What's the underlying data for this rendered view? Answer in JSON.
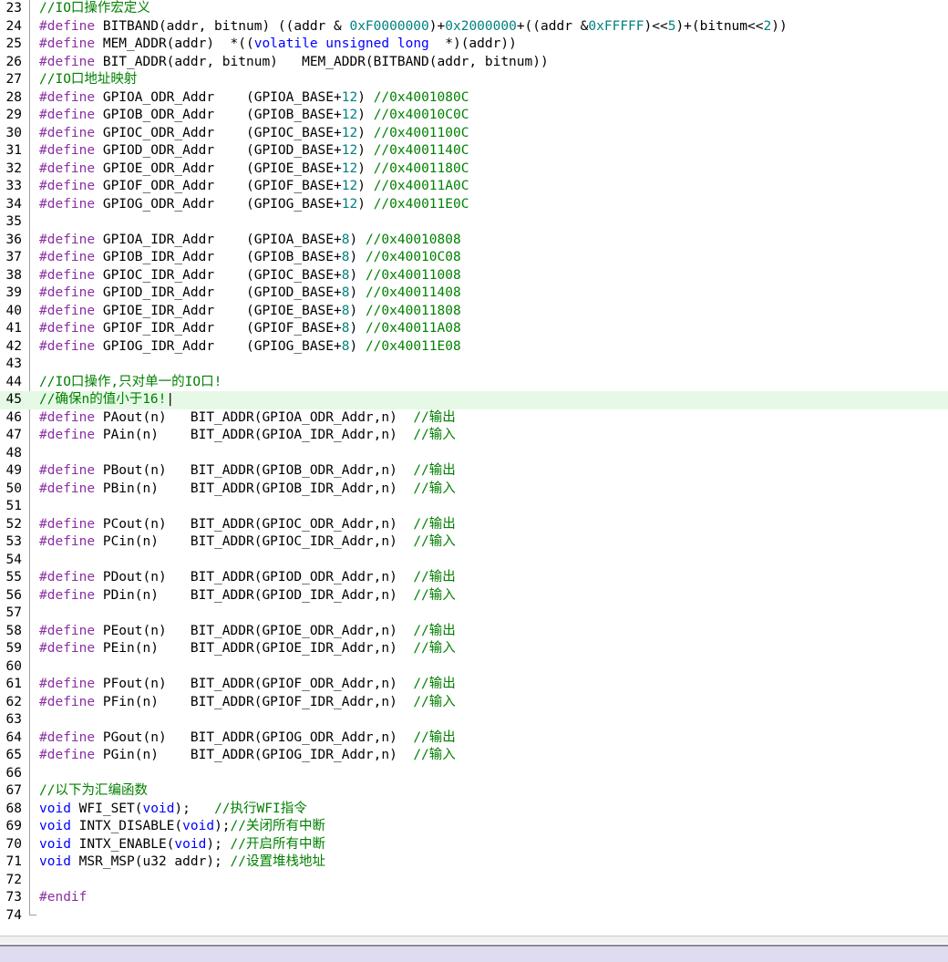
{
  "editor": {
    "lines": [
      {
        "n": "23",
        "tokens": [
          {
            "c": "com",
            "t": "//IO口操作宏定义"
          }
        ]
      },
      {
        "n": "24",
        "tokens": [
          {
            "c": "pre",
            "t": "#define "
          },
          {
            "c": "txt",
            "t": "BITBAND(addr, bitnum) ((addr & "
          },
          {
            "c": "num",
            "t": "0xF0000000"
          },
          {
            "c": "txt",
            "t": ")+"
          },
          {
            "c": "num",
            "t": "0x2000000"
          },
          {
            "c": "txt",
            "t": "+((addr &"
          },
          {
            "c": "num",
            "t": "0xFFFFF"
          },
          {
            "c": "txt",
            "t": ")<<"
          },
          {
            "c": "num",
            "t": "5"
          },
          {
            "c": "txt",
            "t": ")+(bitnum<<"
          },
          {
            "c": "num",
            "t": "2"
          },
          {
            "c": "txt",
            "t": "))"
          }
        ]
      },
      {
        "n": "25",
        "tokens": [
          {
            "c": "pre",
            "t": "#define "
          },
          {
            "c": "txt",
            "t": "MEM_ADDR(addr)  *(("
          },
          {
            "c": "kw",
            "t": "volatile unsigned long"
          },
          {
            "c": "txt",
            "t": "  *)(addr))"
          }
        ]
      },
      {
        "n": "26",
        "tokens": [
          {
            "c": "pre",
            "t": "#define "
          },
          {
            "c": "txt",
            "t": "BIT_ADDR(addr, bitnum)   MEM_ADDR(BITBAND(addr, bitnum))"
          }
        ]
      },
      {
        "n": "27",
        "tokens": [
          {
            "c": "com",
            "t": "//IO口地址映射"
          }
        ]
      },
      {
        "n": "28",
        "tokens": [
          {
            "c": "pre",
            "t": "#define "
          },
          {
            "c": "txt",
            "t": "GPIOA_ODR_Addr    (GPIOA_BASE+"
          },
          {
            "c": "num",
            "t": "12"
          },
          {
            "c": "txt",
            "t": ") "
          },
          {
            "c": "com",
            "t": "//0x4001080C"
          }
        ]
      },
      {
        "n": "29",
        "tokens": [
          {
            "c": "pre",
            "t": "#define "
          },
          {
            "c": "txt",
            "t": "GPIOB_ODR_Addr    (GPIOB_BASE+"
          },
          {
            "c": "num",
            "t": "12"
          },
          {
            "c": "txt",
            "t": ") "
          },
          {
            "c": "com",
            "t": "//0x40010C0C"
          }
        ]
      },
      {
        "n": "30",
        "tokens": [
          {
            "c": "pre",
            "t": "#define "
          },
          {
            "c": "txt",
            "t": "GPIOC_ODR_Addr    (GPIOC_BASE+"
          },
          {
            "c": "num",
            "t": "12"
          },
          {
            "c": "txt",
            "t": ") "
          },
          {
            "c": "com",
            "t": "//0x4001100C"
          }
        ]
      },
      {
        "n": "31",
        "tokens": [
          {
            "c": "pre",
            "t": "#define "
          },
          {
            "c": "txt",
            "t": "GPIOD_ODR_Addr    (GPIOD_BASE+"
          },
          {
            "c": "num",
            "t": "12"
          },
          {
            "c": "txt",
            "t": ") "
          },
          {
            "c": "com",
            "t": "//0x4001140C"
          }
        ]
      },
      {
        "n": "32",
        "tokens": [
          {
            "c": "pre",
            "t": "#define "
          },
          {
            "c": "txt",
            "t": "GPIOE_ODR_Addr    (GPIOE_BASE+"
          },
          {
            "c": "num",
            "t": "12"
          },
          {
            "c": "txt",
            "t": ") "
          },
          {
            "c": "com",
            "t": "//0x4001180C"
          }
        ]
      },
      {
        "n": "33",
        "tokens": [
          {
            "c": "pre",
            "t": "#define "
          },
          {
            "c": "txt",
            "t": "GPIOF_ODR_Addr    (GPIOF_BASE+"
          },
          {
            "c": "num",
            "t": "12"
          },
          {
            "c": "txt",
            "t": ") "
          },
          {
            "c": "com",
            "t": "//0x40011A0C"
          }
        ]
      },
      {
        "n": "34",
        "tokens": [
          {
            "c": "pre",
            "t": "#define "
          },
          {
            "c": "txt",
            "t": "GPIOG_ODR_Addr    (GPIOG_BASE+"
          },
          {
            "c": "num",
            "t": "12"
          },
          {
            "c": "txt",
            "t": ") "
          },
          {
            "c": "com",
            "t": "//0x40011E0C"
          }
        ]
      },
      {
        "n": "35",
        "tokens": []
      },
      {
        "n": "36",
        "tokens": [
          {
            "c": "pre",
            "t": "#define "
          },
          {
            "c": "txt",
            "t": "GPIOA_IDR_Addr    (GPIOA_BASE+"
          },
          {
            "c": "num",
            "t": "8"
          },
          {
            "c": "txt",
            "t": ") "
          },
          {
            "c": "com",
            "t": "//0x40010808"
          }
        ]
      },
      {
        "n": "37",
        "tokens": [
          {
            "c": "pre",
            "t": "#define "
          },
          {
            "c": "txt",
            "t": "GPIOB_IDR_Addr    (GPIOB_BASE+"
          },
          {
            "c": "num",
            "t": "8"
          },
          {
            "c": "txt",
            "t": ") "
          },
          {
            "c": "com",
            "t": "//0x40010C08"
          }
        ]
      },
      {
        "n": "38",
        "tokens": [
          {
            "c": "pre",
            "t": "#define "
          },
          {
            "c": "txt",
            "t": "GPIOC_IDR_Addr    (GPIOC_BASE+"
          },
          {
            "c": "num",
            "t": "8"
          },
          {
            "c": "txt",
            "t": ") "
          },
          {
            "c": "com",
            "t": "//0x40011008"
          }
        ]
      },
      {
        "n": "39",
        "tokens": [
          {
            "c": "pre",
            "t": "#define "
          },
          {
            "c": "txt",
            "t": "GPIOD_IDR_Addr    (GPIOD_BASE+"
          },
          {
            "c": "num",
            "t": "8"
          },
          {
            "c": "txt",
            "t": ") "
          },
          {
            "c": "com",
            "t": "//0x40011408"
          }
        ]
      },
      {
        "n": "40",
        "tokens": [
          {
            "c": "pre",
            "t": "#define "
          },
          {
            "c": "txt",
            "t": "GPIOE_IDR_Addr    (GPIOE_BASE+"
          },
          {
            "c": "num",
            "t": "8"
          },
          {
            "c": "txt",
            "t": ") "
          },
          {
            "c": "com",
            "t": "//0x40011808"
          }
        ]
      },
      {
        "n": "41",
        "tokens": [
          {
            "c": "pre",
            "t": "#define "
          },
          {
            "c": "txt",
            "t": "GPIOF_IDR_Addr    (GPIOF_BASE+"
          },
          {
            "c": "num",
            "t": "8"
          },
          {
            "c": "txt",
            "t": ") "
          },
          {
            "c": "com",
            "t": "//0x40011A08"
          }
        ]
      },
      {
        "n": "42",
        "tokens": [
          {
            "c": "pre",
            "t": "#define "
          },
          {
            "c": "txt",
            "t": "GPIOG_IDR_Addr    (GPIOG_BASE+"
          },
          {
            "c": "num",
            "t": "8"
          },
          {
            "c": "txt",
            "t": ") "
          },
          {
            "c": "com",
            "t": "//0x40011E08"
          }
        ]
      },
      {
        "n": "43",
        "tokens": []
      },
      {
        "n": "44",
        "tokens": [
          {
            "c": "com",
            "t": "//IO口操作,只对单一的IO口!"
          }
        ]
      },
      {
        "n": "45",
        "current": true,
        "tokens": [
          {
            "c": "com",
            "t": "//确保n的值小于16!"
          },
          {
            "c": "txt",
            "t": "|"
          }
        ]
      },
      {
        "n": "46",
        "tokens": [
          {
            "c": "pre",
            "t": "#define "
          },
          {
            "c": "txt",
            "t": "PAout(n)   BIT_ADDR(GPIOA_ODR_Addr,n)  "
          },
          {
            "c": "com",
            "t": "//输出"
          }
        ]
      },
      {
        "n": "47",
        "tokens": [
          {
            "c": "pre",
            "t": "#define "
          },
          {
            "c": "txt",
            "t": "PAin(n)    BIT_ADDR(GPIOA_IDR_Addr,n)  "
          },
          {
            "c": "com",
            "t": "//输入"
          }
        ]
      },
      {
        "n": "48",
        "tokens": []
      },
      {
        "n": "49",
        "tokens": [
          {
            "c": "pre",
            "t": "#define "
          },
          {
            "c": "txt",
            "t": "PBout(n)   BIT_ADDR(GPIOB_ODR_Addr,n)  "
          },
          {
            "c": "com",
            "t": "//输出"
          }
        ]
      },
      {
        "n": "50",
        "tokens": [
          {
            "c": "pre",
            "t": "#define "
          },
          {
            "c": "txt",
            "t": "PBin(n)    BIT_ADDR(GPIOB_IDR_Addr,n)  "
          },
          {
            "c": "com",
            "t": "//输入"
          }
        ]
      },
      {
        "n": "51",
        "tokens": []
      },
      {
        "n": "52",
        "tokens": [
          {
            "c": "pre",
            "t": "#define "
          },
          {
            "c": "txt",
            "t": "PCout(n)   BIT_ADDR(GPIOC_ODR_Addr,n)  "
          },
          {
            "c": "com",
            "t": "//输出"
          }
        ]
      },
      {
        "n": "53",
        "tokens": [
          {
            "c": "pre",
            "t": "#define "
          },
          {
            "c": "txt",
            "t": "PCin(n)    BIT_ADDR(GPIOC_IDR_Addr,n)  "
          },
          {
            "c": "com",
            "t": "//输入"
          }
        ]
      },
      {
        "n": "54",
        "tokens": []
      },
      {
        "n": "55",
        "tokens": [
          {
            "c": "pre",
            "t": "#define "
          },
          {
            "c": "txt",
            "t": "PDout(n)   BIT_ADDR(GPIOD_ODR_Addr,n)  "
          },
          {
            "c": "com",
            "t": "//输出"
          }
        ]
      },
      {
        "n": "56",
        "tokens": [
          {
            "c": "pre",
            "t": "#define "
          },
          {
            "c": "txt",
            "t": "PDin(n)    BIT_ADDR(GPIOD_IDR_Addr,n)  "
          },
          {
            "c": "com",
            "t": "//输入"
          }
        ]
      },
      {
        "n": "57",
        "tokens": []
      },
      {
        "n": "58",
        "tokens": [
          {
            "c": "pre",
            "t": "#define "
          },
          {
            "c": "txt",
            "t": "PEout(n)   BIT_ADDR(GPIOE_ODR_Addr,n)  "
          },
          {
            "c": "com",
            "t": "//输出"
          }
        ]
      },
      {
        "n": "59",
        "tokens": [
          {
            "c": "pre",
            "t": "#define "
          },
          {
            "c": "txt",
            "t": "PEin(n)    BIT_ADDR(GPIOE_IDR_Addr,n)  "
          },
          {
            "c": "com",
            "t": "//输入"
          }
        ]
      },
      {
        "n": "60",
        "tokens": []
      },
      {
        "n": "61",
        "tokens": [
          {
            "c": "pre",
            "t": "#define "
          },
          {
            "c": "txt",
            "t": "PFout(n)   BIT_ADDR(GPIOF_ODR_Addr,n)  "
          },
          {
            "c": "com",
            "t": "//输出"
          }
        ]
      },
      {
        "n": "62",
        "tokens": [
          {
            "c": "pre",
            "t": "#define "
          },
          {
            "c": "txt",
            "t": "PFin(n)    BIT_ADDR(GPIOF_IDR_Addr,n)  "
          },
          {
            "c": "com",
            "t": "//输入"
          }
        ]
      },
      {
        "n": "63",
        "tokens": []
      },
      {
        "n": "64",
        "tokens": [
          {
            "c": "pre",
            "t": "#define "
          },
          {
            "c": "txt",
            "t": "PGout(n)   BIT_ADDR(GPIOG_ODR_Addr,n)  "
          },
          {
            "c": "com",
            "t": "//输出"
          }
        ]
      },
      {
        "n": "65",
        "tokens": [
          {
            "c": "pre",
            "t": "#define "
          },
          {
            "c": "txt",
            "t": "PGin(n)    BIT_ADDR(GPIOG_IDR_Addr,n)  "
          },
          {
            "c": "com",
            "t": "//输入"
          }
        ]
      },
      {
        "n": "66",
        "tokens": []
      },
      {
        "n": "67",
        "tokens": [
          {
            "c": "com",
            "t": "//以下为汇编函数"
          }
        ]
      },
      {
        "n": "68",
        "tokens": [
          {
            "c": "kw",
            "t": "void"
          },
          {
            "c": "txt",
            "t": " WFI_SET("
          },
          {
            "c": "kw",
            "t": "void"
          },
          {
            "c": "txt",
            "t": ");   "
          },
          {
            "c": "com",
            "t": "//执行WFI指令"
          }
        ]
      },
      {
        "n": "69",
        "tokens": [
          {
            "c": "kw",
            "t": "void"
          },
          {
            "c": "txt",
            "t": " INTX_DISABLE("
          },
          {
            "c": "kw",
            "t": "void"
          },
          {
            "c": "txt",
            "t": ");"
          },
          {
            "c": "com",
            "t": "//关闭所有中断"
          }
        ]
      },
      {
        "n": "70",
        "tokens": [
          {
            "c": "kw",
            "t": "void"
          },
          {
            "c": "txt",
            "t": " INTX_ENABLE("
          },
          {
            "c": "kw",
            "t": "void"
          },
          {
            "c": "txt",
            "t": "); "
          },
          {
            "c": "com",
            "t": "//开启所有中断"
          }
        ]
      },
      {
        "n": "71",
        "tokens": [
          {
            "c": "kw",
            "t": "void"
          },
          {
            "c": "txt",
            "t": " MSR_MSP(u32 addr); "
          },
          {
            "c": "com",
            "t": "//设置堆栈地址"
          }
        ]
      },
      {
        "n": "72",
        "tokens": []
      },
      {
        "n": "73",
        "tokens": [
          {
            "c": "pre",
            "t": "#endif"
          }
        ]
      },
      {
        "n": "74",
        "tokens": []
      }
    ]
  }
}
